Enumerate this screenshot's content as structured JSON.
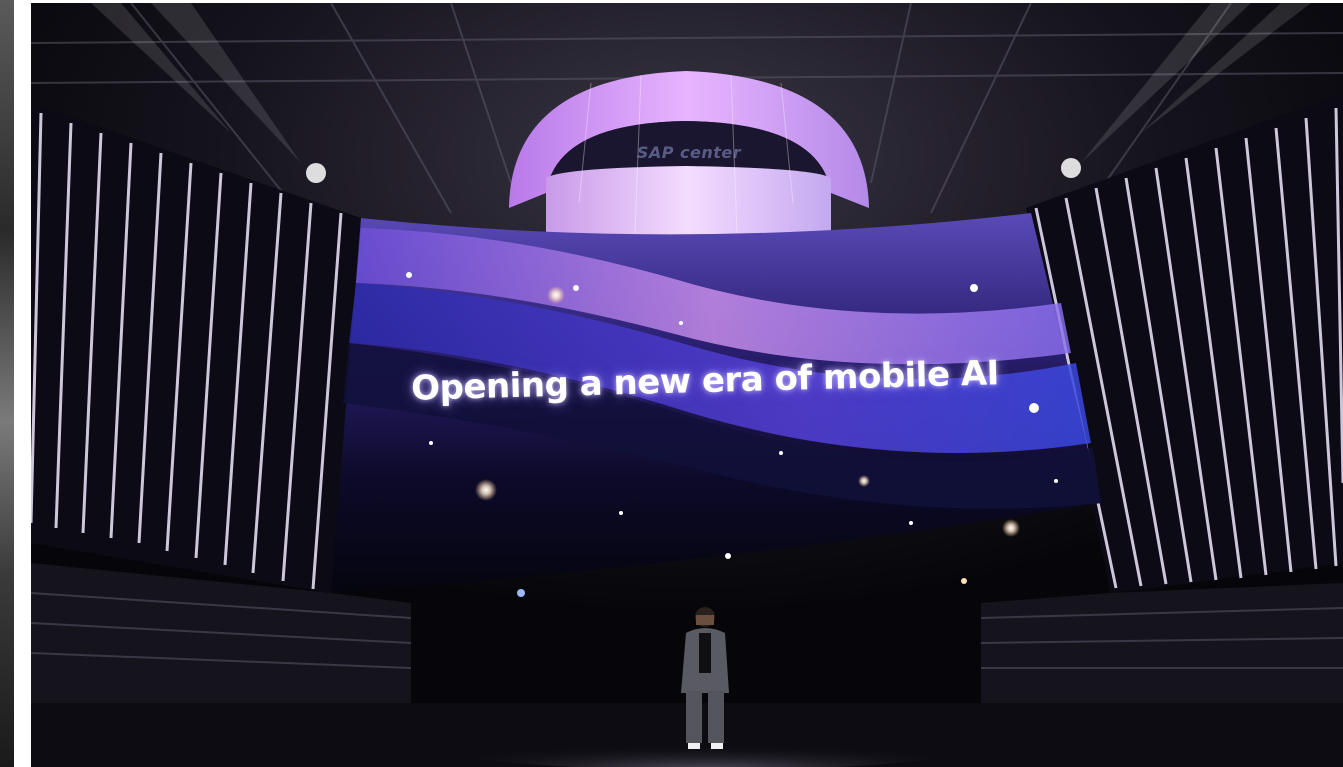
{
  "photo": {
    "screen_headline": "Opening a new era of mobile AI",
    "scoreboard_text": "SAP center"
  },
  "colors": {
    "background_frame": "#ffffff",
    "stage_dark": "#04040a",
    "screen_purple": "#8a5cf0",
    "screen_violet_glow": "#c890f0",
    "scoreboard_pink": "#e6b0ff",
    "led_column_lines": "#f0e8ff"
  }
}
